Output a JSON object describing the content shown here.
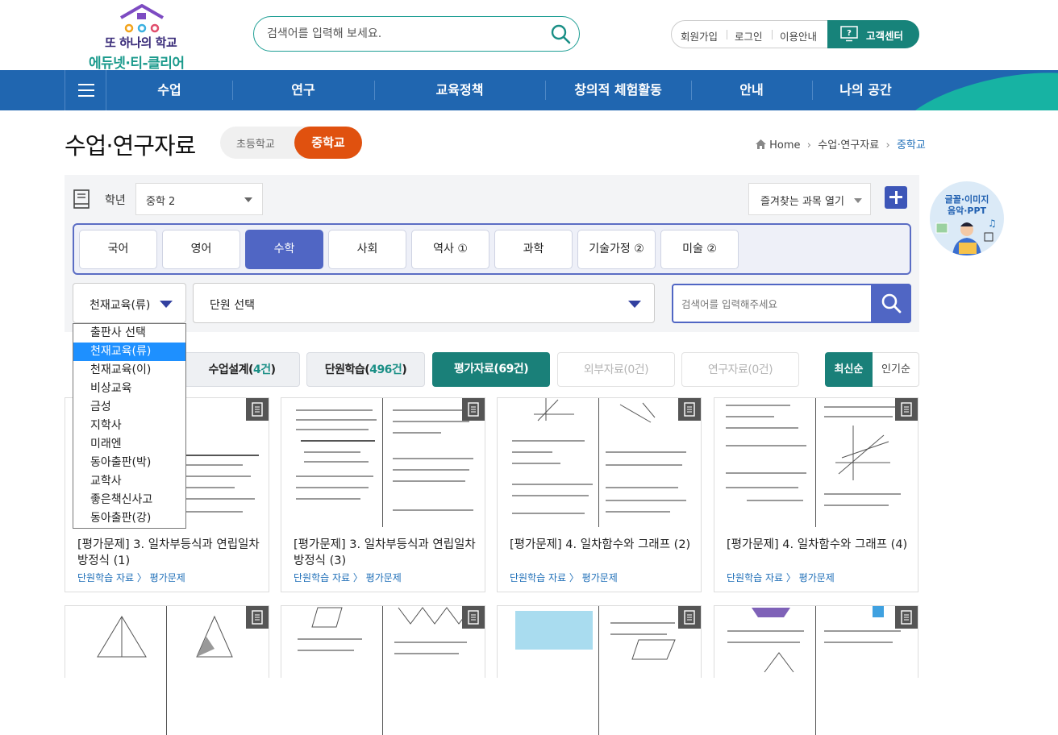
{
  "header": {
    "logo_line1": "또 하나의 학교",
    "logo_line2": "에듀넷·티-클리어",
    "search_placeholder": "검색어를 입력해 보세요.",
    "util_links": [
      "회원가입",
      "로그인",
      "이용안내"
    ],
    "support_label": "고객센터"
  },
  "nav": {
    "items": [
      "수업",
      "연구",
      "교육정책",
      "창의적 체험활동",
      "안내",
      "나의 공간"
    ]
  },
  "page": {
    "title": "수업·연구자료",
    "school_tabs": [
      "초등학교",
      "중학교"
    ],
    "active_school": "중학교",
    "breadcrumb": [
      "Home",
      "수업·연구자료",
      "중학교"
    ]
  },
  "filters": {
    "grade_label": "학년",
    "grade_value": "중학 2",
    "favorites_label": "즐겨찾는 과목 열기",
    "subjects": [
      "국어",
      "영어",
      "수학",
      "사회",
      "역사 ①",
      "과학",
      "기술가정 ②",
      "미술 ②"
    ],
    "active_subject": "수학",
    "publisher_value": "천재교육(류)",
    "unit_value": "단원 선택",
    "keyword_placeholder": "검색어를 입력해주세요",
    "publisher_options": [
      "출판사 선택",
      "천재교육(류)",
      "천재교육(이)",
      "비상교육",
      "금성",
      "지학사",
      "미래엔",
      "동아출판(박)",
      "교학사",
      "좋은책신사고",
      "동아출판(강)"
    ],
    "selected_publisher_index": 1
  },
  "categories": [
    {
      "label": "수업설계",
      "count": "4건"
    },
    {
      "label": "단원학습",
      "count": "496건"
    },
    {
      "label": "평가자료",
      "count": "69건"
    },
    {
      "label": "외부자료",
      "count": "0건"
    },
    {
      "label": "연구자료",
      "count": "0건"
    }
  ],
  "sort": {
    "newest": "최신순",
    "popular": "인기순"
  },
  "cards": [
    {
      "title": "[평가문제] 3. 일차부등식과 연립일차방정식 (1)",
      "meta": "단원학습 자료 〉 평가문제"
    },
    {
      "title": "[평가문제] 3. 일차부등식과 연립일차방정식 (3)",
      "meta": "단원학습 자료 〉 평가문제"
    },
    {
      "title": "[평가문제] 4. 일차함수와 그래프 (2)",
      "meta": "단원학습 자료 〉 평가문제"
    },
    {
      "title": "[평가문제] 4. 일차함수와 그래프 (4)",
      "meta": "단원학습 자료 〉 평가문제"
    }
  ],
  "banner": {
    "line1": "글꼴·이미지",
    "line2": "음악·PPT"
  },
  "colors": {
    "nav": "#2066b0",
    "teal": "#1a8079",
    "accent_orange": "#e0510f",
    "subject_active": "#5066c4"
  }
}
